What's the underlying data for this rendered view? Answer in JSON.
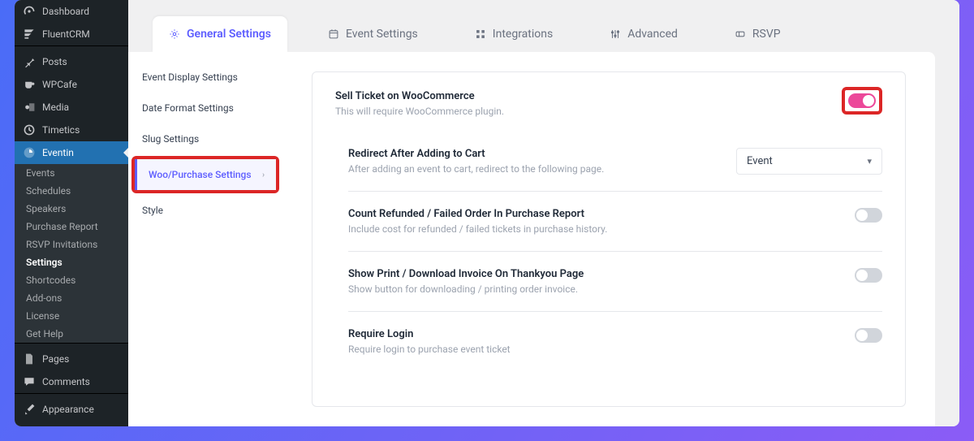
{
  "sidebar": {
    "items": [
      {
        "label": "Dashboard",
        "icon": "gauge-icon"
      },
      {
        "label": "FluentCRM",
        "icon": "fluent-icon"
      },
      {
        "label": "Posts",
        "icon": "pin-icon"
      },
      {
        "label": "WPCafe",
        "icon": "cafe-icon"
      },
      {
        "label": "Media",
        "icon": "media-icon"
      },
      {
        "label": "Timetics",
        "icon": "clock-icon"
      },
      {
        "label": "Eventin",
        "icon": "eventin-icon",
        "active": true
      }
    ],
    "sub": [
      "Events",
      "Schedules",
      "Speakers",
      "Purchase Report",
      "RSVP Invitations",
      "Settings",
      "Shortcodes",
      "Add-ons",
      "License",
      "Get Help"
    ],
    "sub_active": "Settings",
    "items2": [
      {
        "label": "Pages",
        "icon": "page-icon"
      },
      {
        "label": "Comments",
        "icon": "comment-icon"
      },
      {
        "label": "Appearance",
        "icon": "brush-icon"
      }
    ]
  },
  "tabs": [
    {
      "label": "General Settings",
      "icon": "gear-icon",
      "active": true
    },
    {
      "label": "Event Settings",
      "icon": "calendar-icon"
    },
    {
      "label": "Integrations",
      "icon": "grid-icon"
    },
    {
      "label": "Advanced",
      "icon": "sliders-icon"
    },
    {
      "label": "RSVP",
      "icon": "ticket-icon"
    }
  ],
  "subnav": [
    "Event Display Settings",
    "Date Format Settings",
    "Slug Settings",
    "Woo/Purchase Settings",
    "Style"
  ],
  "subnav_active": "Woo/Purchase Settings",
  "settings": {
    "sell": {
      "title": "Sell Ticket on WooCommerce",
      "desc": "This will require WooCommerce plugin.",
      "on": true
    },
    "redirect": {
      "title": "Redirect After Adding to Cart",
      "desc": "After adding an event to cart, redirect to the following page.",
      "select_value": "Event"
    },
    "refunded": {
      "title": "Count Refunded / Failed Order In Purchase Report",
      "desc": "Include cost for refunded / failed tickets in purchase history.",
      "on": false
    },
    "invoice": {
      "title": "Show Print / Download Invoice On Thankyou Page",
      "desc": "Show button for downloading / printing order invoice.",
      "on": false
    },
    "login": {
      "title": "Require Login",
      "desc": "Require login to purchase event ticket",
      "on": false
    }
  }
}
